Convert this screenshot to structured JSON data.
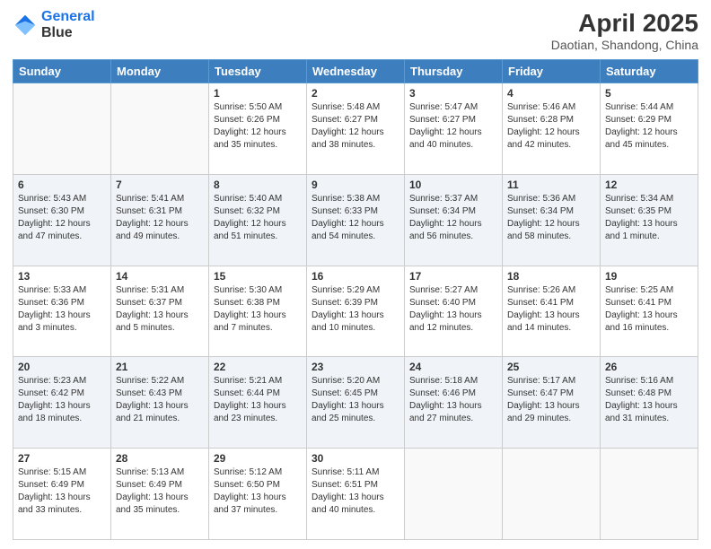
{
  "logo": {
    "line1": "General",
    "line2": "Blue"
  },
  "title": "April 2025",
  "subtitle": "Daotian, Shandong, China",
  "days_header": [
    "Sunday",
    "Monday",
    "Tuesday",
    "Wednesday",
    "Thursday",
    "Friday",
    "Saturday"
  ],
  "weeks": [
    [
      {
        "day": "",
        "sunrise": "",
        "sunset": "",
        "daylight": ""
      },
      {
        "day": "",
        "sunrise": "",
        "sunset": "",
        "daylight": ""
      },
      {
        "day": "1",
        "sunrise": "Sunrise: 5:50 AM",
        "sunset": "Sunset: 6:26 PM",
        "daylight": "Daylight: 12 hours and 35 minutes."
      },
      {
        "day": "2",
        "sunrise": "Sunrise: 5:48 AM",
        "sunset": "Sunset: 6:27 PM",
        "daylight": "Daylight: 12 hours and 38 minutes."
      },
      {
        "day": "3",
        "sunrise": "Sunrise: 5:47 AM",
        "sunset": "Sunset: 6:27 PM",
        "daylight": "Daylight: 12 hours and 40 minutes."
      },
      {
        "day": "4",
        "sunrise": "Sunrise: 5:46 AM",
        "sunset": "Sunset: 6:28 PM",
        "daylight": "Daylight: 12 hours and 42 minutes."
      },
      {
        "day": "5",
        "sunrise": "Sunrise: 5:44 AM",
        "sunset": "Sunset: 6:29 PM",
        "daylight": "Daylight: 12 hours and 45 minutes."
      }
    ],
    [
      {
        "day": "6",
        "sunrise": "Sunrise: 5:43 AM",
        "sunset": "Sunset: 6:30 PM",
        "daylight": "Daylight: 12 hours and 47 minutes."
      },
      {
        "day": "7",
        "sunrise": "Sunrise: 5:41 AM",
        "sunset": "Sunset: 6:31 PM",
        "daylight": "Daylight: 12 hours and 49 minutes."
      },
      {
        "day": "8",
        "sunrise": "Sunrise: 5:40 AM",
        "sunset": "Sunset: 6:32 PM",
        "daylight": "Daylight: 12 hours and 51 minutes."
      },
      {
        "day": "9",
        "sunrise": "Sunrise: 5:38 AM",
        "sunset": "Sunset: 6:33 PM",
        "daylight": "Daylight: 12 hours and 54 minutes."
      },
      {
        "day": "10",
        "sunrise": "Sunrise: 5:37 AM",
        "sunset": "Sunset: 6:34 PM",
        "daylight": "Daylight: 12 hours and 56 minutes."
      },
      {
        "day": "11",
        "sunrise": "Sunrise: 5:36 AM",
        "sunset": "Sunset: 6:34 PM",
        "daylight": "Daylight: 12 hours and 58 minutes."
      },
      {
        "day": "12",
        "sunrise": "Sunrise: 5:34 AM",
        "sunset": "Sunset: 6:35 PM",
        "daylight": "Daylight: 13 hours and 1 minute."
      }
    ],
    [
      {
        "day": "13",
        "sunrise": "Sunrise: 5:33 AM",
        "sunset": "Sunset: 6:36 PM",
        "daylight": "Daylight: 13 hours and 3 minutes."
      },
      {
        "day": "14",
        "sunrise": "Sunrise: 5:31 AM",
        "sunset": "Sunset: 6:37 PM",
        "daylight": "Daylight: 13 hours and 5 minutes."
      },
      {
        "day": "15",
        "sunrise": "Sunrise: 5:30 AM",
        "sunset": "Sunset: 6:38 PM",
        "daylight": "Daylight: 13 hours and 7 minutes."
      },
      {
        "day": "16",
        "sunrise": "Sunrise: 5:29 AM",
        "sunset": "Sunset: 6:39 PM",
        "daylight": "Daylight: 13 hours and 10 minutes."
      },
      {
        "day": "17",
        "sunrise": "Sunrise: 5:27 AM",
        "sunset": "Sunset: 6:40 PM",
        "daylight": "Daylight: 13 hours and 12 minutes."
      },
      {
        "day": "18",
        "sunrise": "Sunrise: 5:26 AM",
        "sunset": "Sunset: 6:41 PM",
        "daylight": "Daylight: 13 hours and 14 minutes."
      },
      {
        "day": "19",
        "sunrise": "Sunrise: 5:25 AM",
        "sunset": "Sunset: 6:41 PM",
        "daylight": "Daylight: 13 hours and 16 minutes."
      }
    ],
    [
      {
        "day": "20",
        "sunrise": "Sunrise: 5:23 AM",
        "sunset": "Sunset: 6:42 PM",
        "daylight": "Daylight: 13 hours and 18 minutes."
      },
      {
        "day": "21",
        "sunrise": "Sunrise: 5:22 AM",
        "sunset": "Sunset: 6:43 PM",
        "daylight": "Daylight: 13 hours and 21 minutes."
      },
      {
        "day": "22",
        "sunrise": "Sunrise: 5:21 AM",
        "sunset": "Sunset: 6:44 PM",
        "daylight": "Daylight: 13 hours and 23 minutes."
      },
      {
        "day": "23",
        "sunrise": "Sunrise: 5:20 AM",
        "sunset": "Sunset: 6:45 PM",
        "daylight": "Daylight: 13 hours and 25 minutes."
      },
      {
        "day": "24",
        "sunrise": "Sunrise: 5:18 AM",
        "sunset": "Sunset: 6:46 PM",
        "daylight": "Daylight: 13 hours and 27 minutes."
      },
      {
        "day": "25",
        "sunrise": "Sunrise: 5:17 AM",
        "sunset": "Sunset: 6:47 PM",
        "daylight": "Daylight: 13 hours and 29 minutes."
      },
      {
        "day": "26",
        "sunrise": "Sunrise: 5:16 AM",
        "sunset": "Sunset: 6:48 PM",
        "daylight": "Daylight: 13 hours and 31 minutes."
      }
    ],
    [
      {
        "day": "27",
        "sunrise": "Sunrise: 5:15 AM",
        "sunset": "Sunset: 6:49 PM",
        "daylight": "Daylight: 13 hours and 33 minutes."
      },
      {
        "day": "28",
        "sunrise": "Sunrise: 5:13 AM",
        "sunset": "Sunset: 6:49 PM",
        "daylight": "Daylight: 13 hours and 35 minutes."
      },
      {
        "day": "29",
        "sunrise": "Sunrise: 5:12 AM",
        "sunset": "Sunset: 6:50 PM",
        "daylight": "Daylight: 13 hours and 37 minutes."
      },
      {
        "day": "30",
        "sunrise": "Sunrise: 5:11 AM",
        "sunset": "Sunset: 6:51 PM",
        "daylight": "Daylight: 13 hours and 40 minutes."
      },
      {
        "day": "",
        "sunrise": "",
        "sunset": "",
        "daylight": ""
      },
      {
        "day": "",
        "sunrise": "",
        "sunset": "",
        "daylight": ""
      },
      {
        "day": "",
        "sunrise": "",
        "sunset": "",
        "daylight": ""
      }
    ]
  ]
}
